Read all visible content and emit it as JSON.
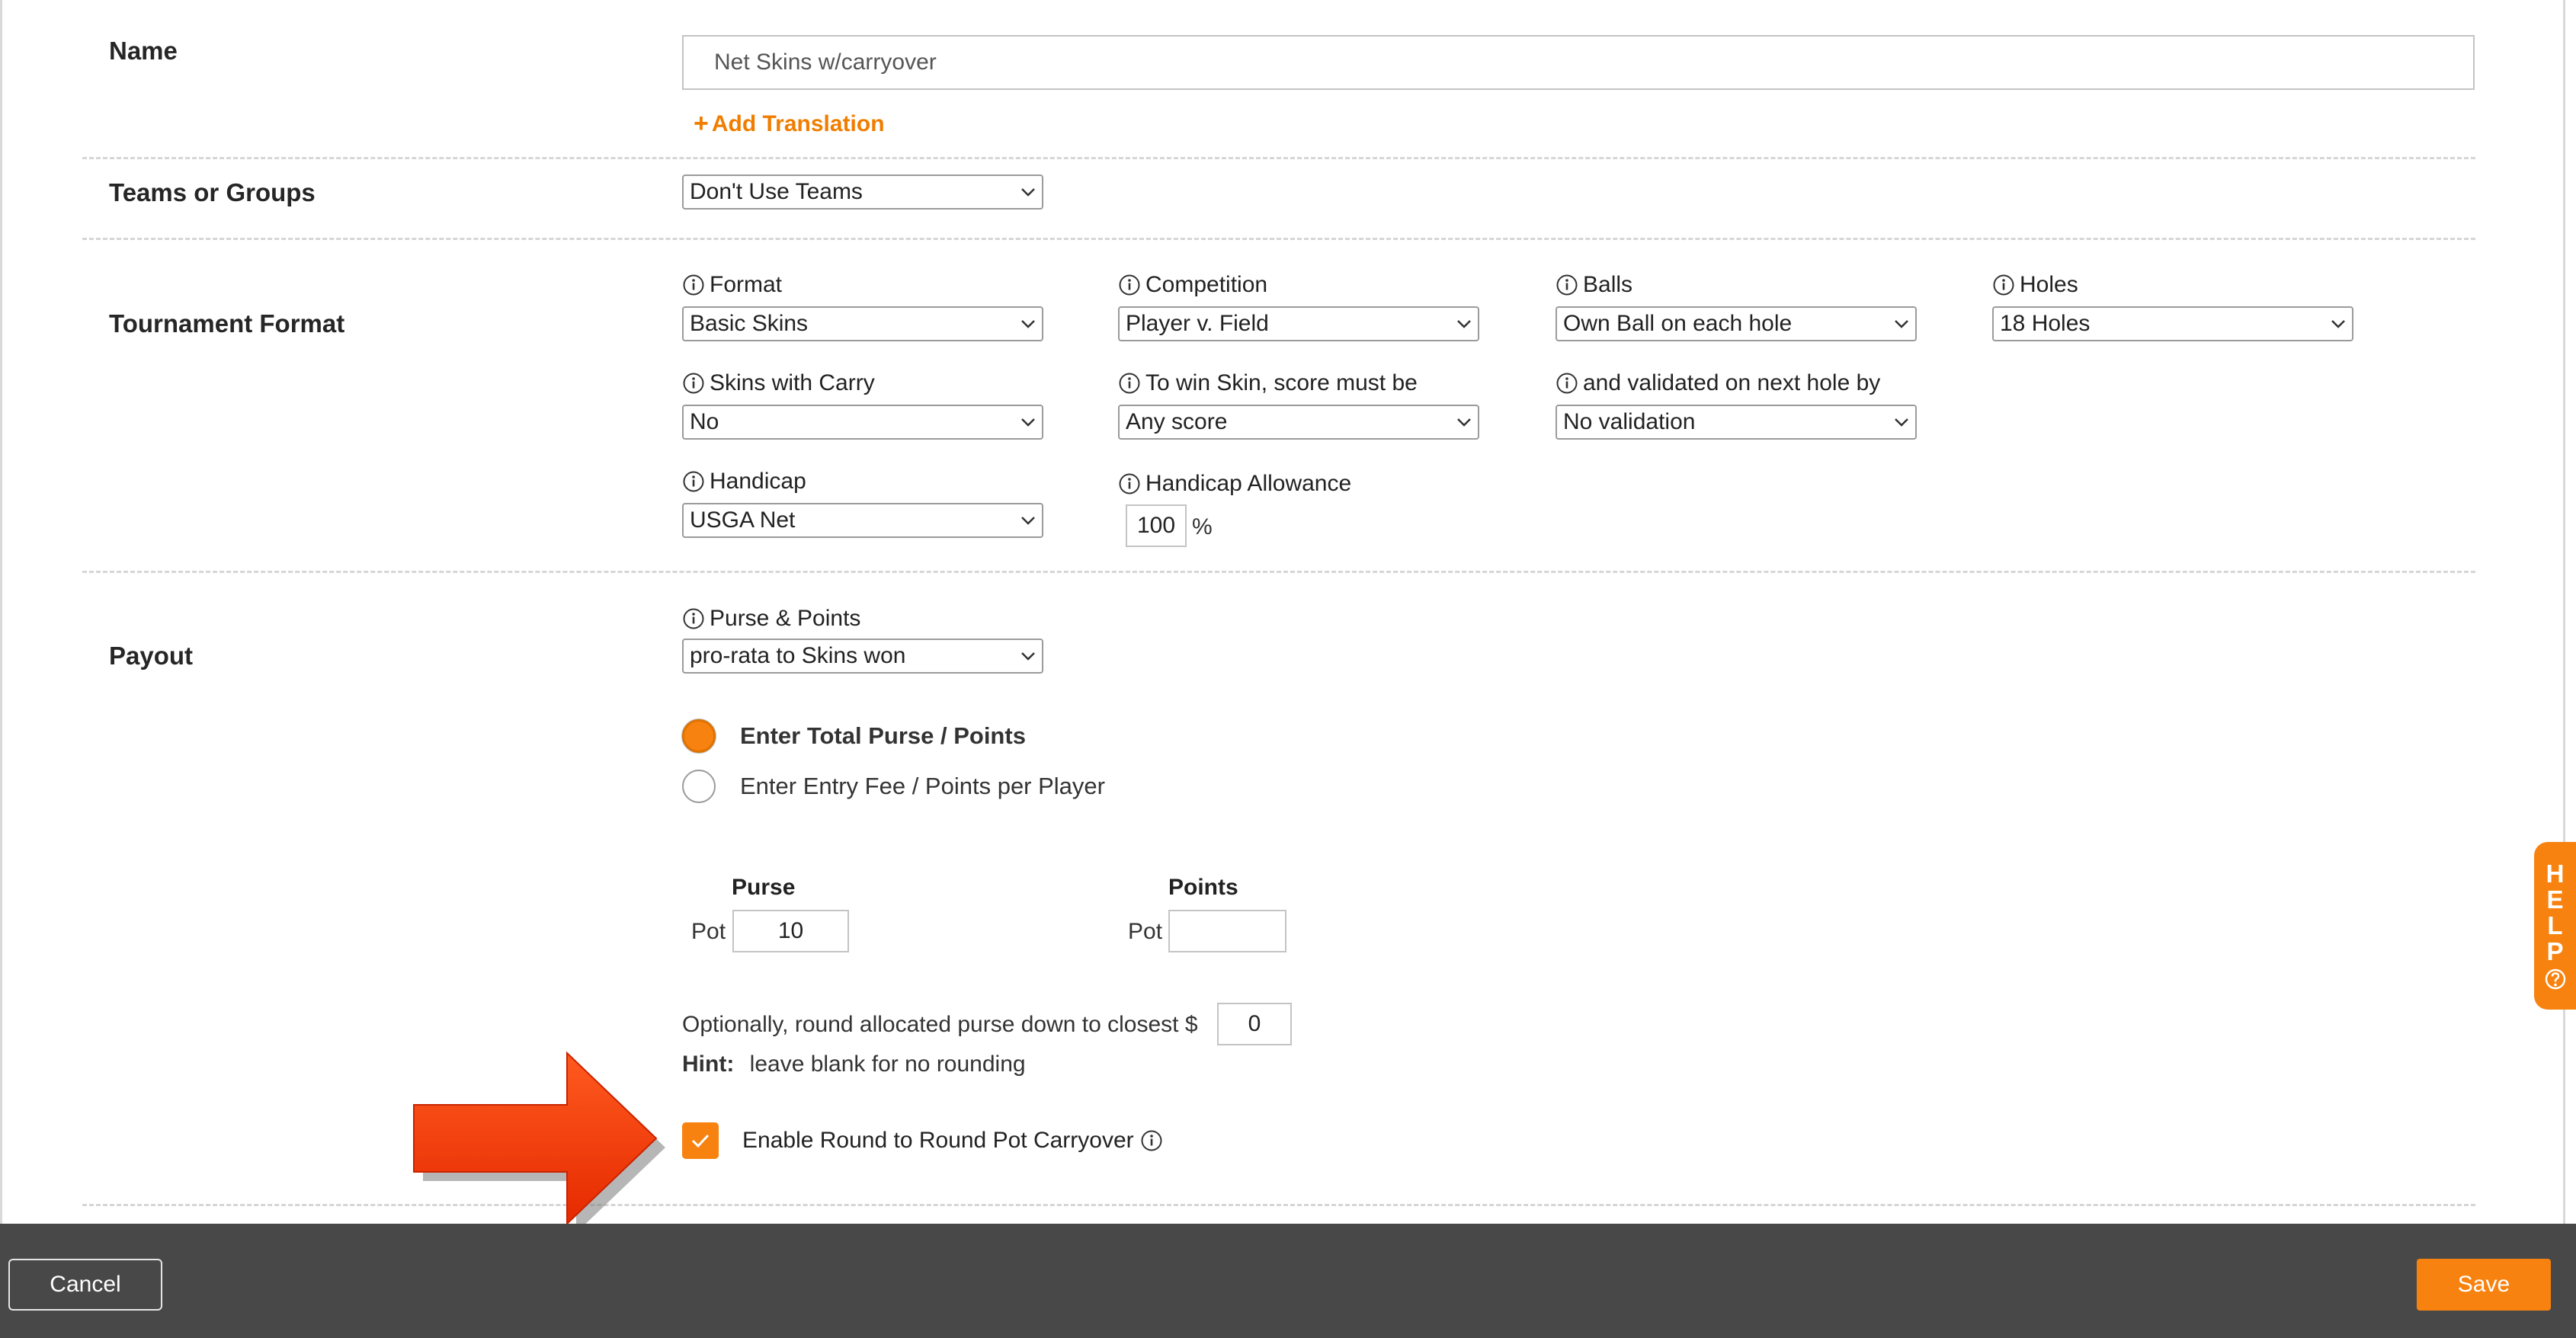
{
  "colors": {
    "accent": "#f7820f",
    "footer_bg": "#484848",
    "arrow": "#ff3d00"
  },
  "name_section": {
    "label": "Name",
    "value": "Net Skins w/carryover",
    "add_translation": "Add Translation"
  },
  "teams_section": {
    "label": "Teams or Groups",
    "selected": "Don't Use Teams"
  },
  "format_section": {
    "label": "Tournament Format",
    "format": {
      "label": "Format",
      "value": "Basic Skins"
    },
    "competition": {
      "label": "Competition",
      "value": "Player v. Field"
    },
    "balls": {
      "label": "Balls",
      "value": "Own Ball on each hole"
    },
    "holes": {
      "label": "Holes",
      "value": "18 Holes"
    },
    "skins_carry": {
      "label": "Skins with Carry",
      "value": "No"
    },
    "win_score": {
      "label": "To win Skin, score must be",
      "value": "Any score"
    },
    "validation": {
      "label": "and validated on next hole by",
      "value": "No validation"
    },
    "handicap": {
      "label": "Handicap",
      "value": "USGA Net"
    },
    "allowance": {
      "label": "Handicap Allowance",
      "value": "100",
      "unit": "%"
    }
  },
  "payout_section": {
    "label": "Payout",
    "purse_points": {
      "label": "Purse & Points",
      "value": "pro-rata to Skins won"
    },
    "radio_total": "Enter Total Purse / Points",
    "radio_entry": "Enter Entry Fee / Points per Player",
    "purse_head": "Purse",
    "points_head": "Points",
    "pot_label": "Pot",
    "purse_pot": "10",
    "points_pot": "",
    "round_label": "Optionally, round allocated purse down to closest $",
    "round_value": "0",
    "hint_label": "Hint:",
    "hint_text": "leave blank for no rounding",
    "carryover_label": "Enable Round to Round Pot Carryover",
    "carryover_checked": true
  },
  "help_tab": {
    "letters": [
      "H",
      "E",
      "L",
      "P"
    ]
  },
  "footer": {
    "cancel": "Cancel",
    "save": "Save"
  }
}
